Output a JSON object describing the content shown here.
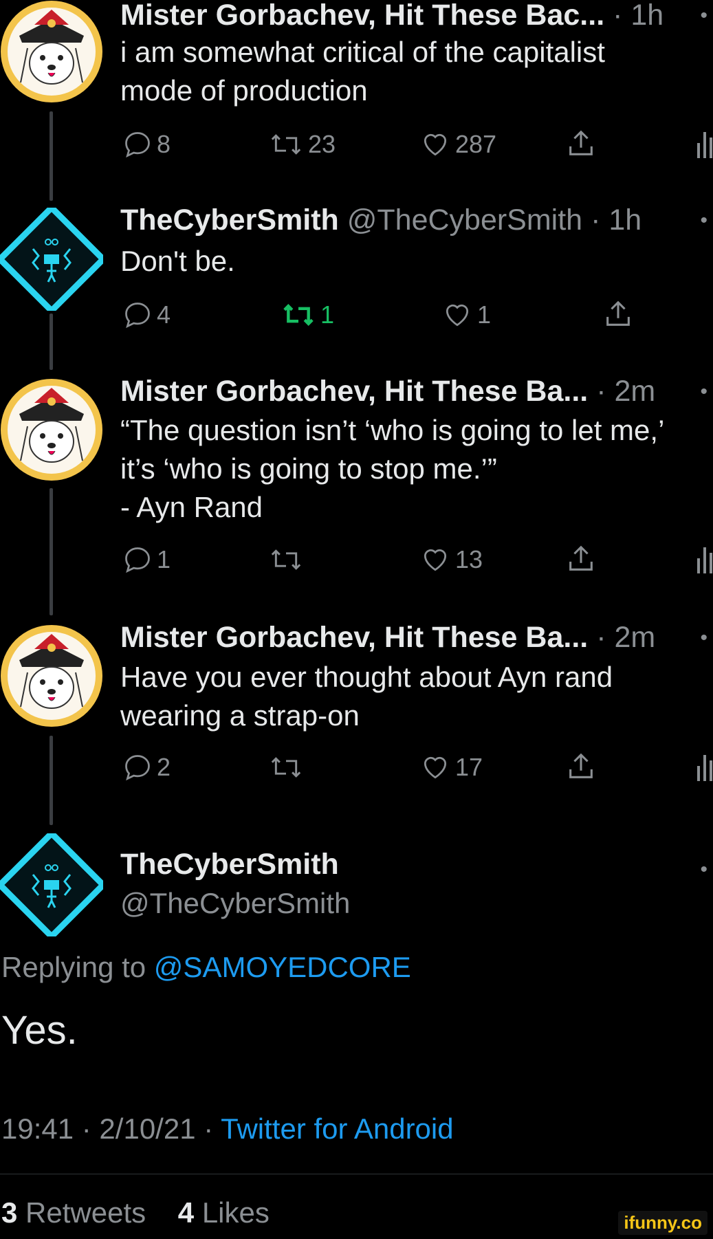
{
  "tweets": [
    {
      "author": "Mister Gorbachev, Hit These Bac...",
      "handle": "",
      "time": "· 1h",
      "lines": [
        "i am somewhat critical of the capitalist",
        "mode of production"
      ],
      "replies": "8",
      "retweets": "23",
      "likes": "287"
    },
    {
      "author": "TheCyberSmith",
      "handle": "@TheCyberSmith",
      "time": "· 1h",
      "lines": [
        "Don't be."
      ],
      "replies": "4",
      "retweets": "1",
      "likes": "1"
    },
    {
      "author": "Mister Gorbachev, Hit These Ba...",
      "handle": "",
      "time": "· 2m",
      "lines": [
        "“The question isn’t ‘who is going to let me,’",
        "it’s ‘who is going to stop me.’”",
        "- Ayn Rand"
      ],
      "replies": "1",
      "retweets": "",
      "likes": "13"
    },
    {
      "author": "Mister Gorbachev, Hit These Ba...",
      "handle": "",
      "time": "· 2m",
      "lines": [
        "Have you ever thought about Ayn rand",
        "wearing a strap-on"
      ],
      "replies": "2",
      "retweets": "",
      "likes": "17"
    }
  ],
  "focus": {
    "author": "TheCyberSmith",
    "handle": "@TheCyberSmith",
    "replying_prefix": "Replying to ",
    "replying_to": "@SAMOYEDCORE",
    "text": "Yes.",
    "timestamp": "19:41 · 2/10/21 · ",
    "source": "Twitter for Android",
    "retweet_count": "3",
    "retweet_label": "Retweets",
    "like_count": "4",
    "like_label": "Likes"
  },
  "more_dot": "•",
  "watermark": "ifunny.co",
  "colors": {
    "background": "#000000",
    "link": "#1d9bf0",
    "retweeted": "#17bf63",
    "avatar_ring": "#f3c44b",
    "cyber": "#2ad4f0"
  },
  "icons": [
    "reply-icon",
    "retweet-icon",
    "like-icon",
    "share-icon",
    "analytics-icon"
  ]
}
